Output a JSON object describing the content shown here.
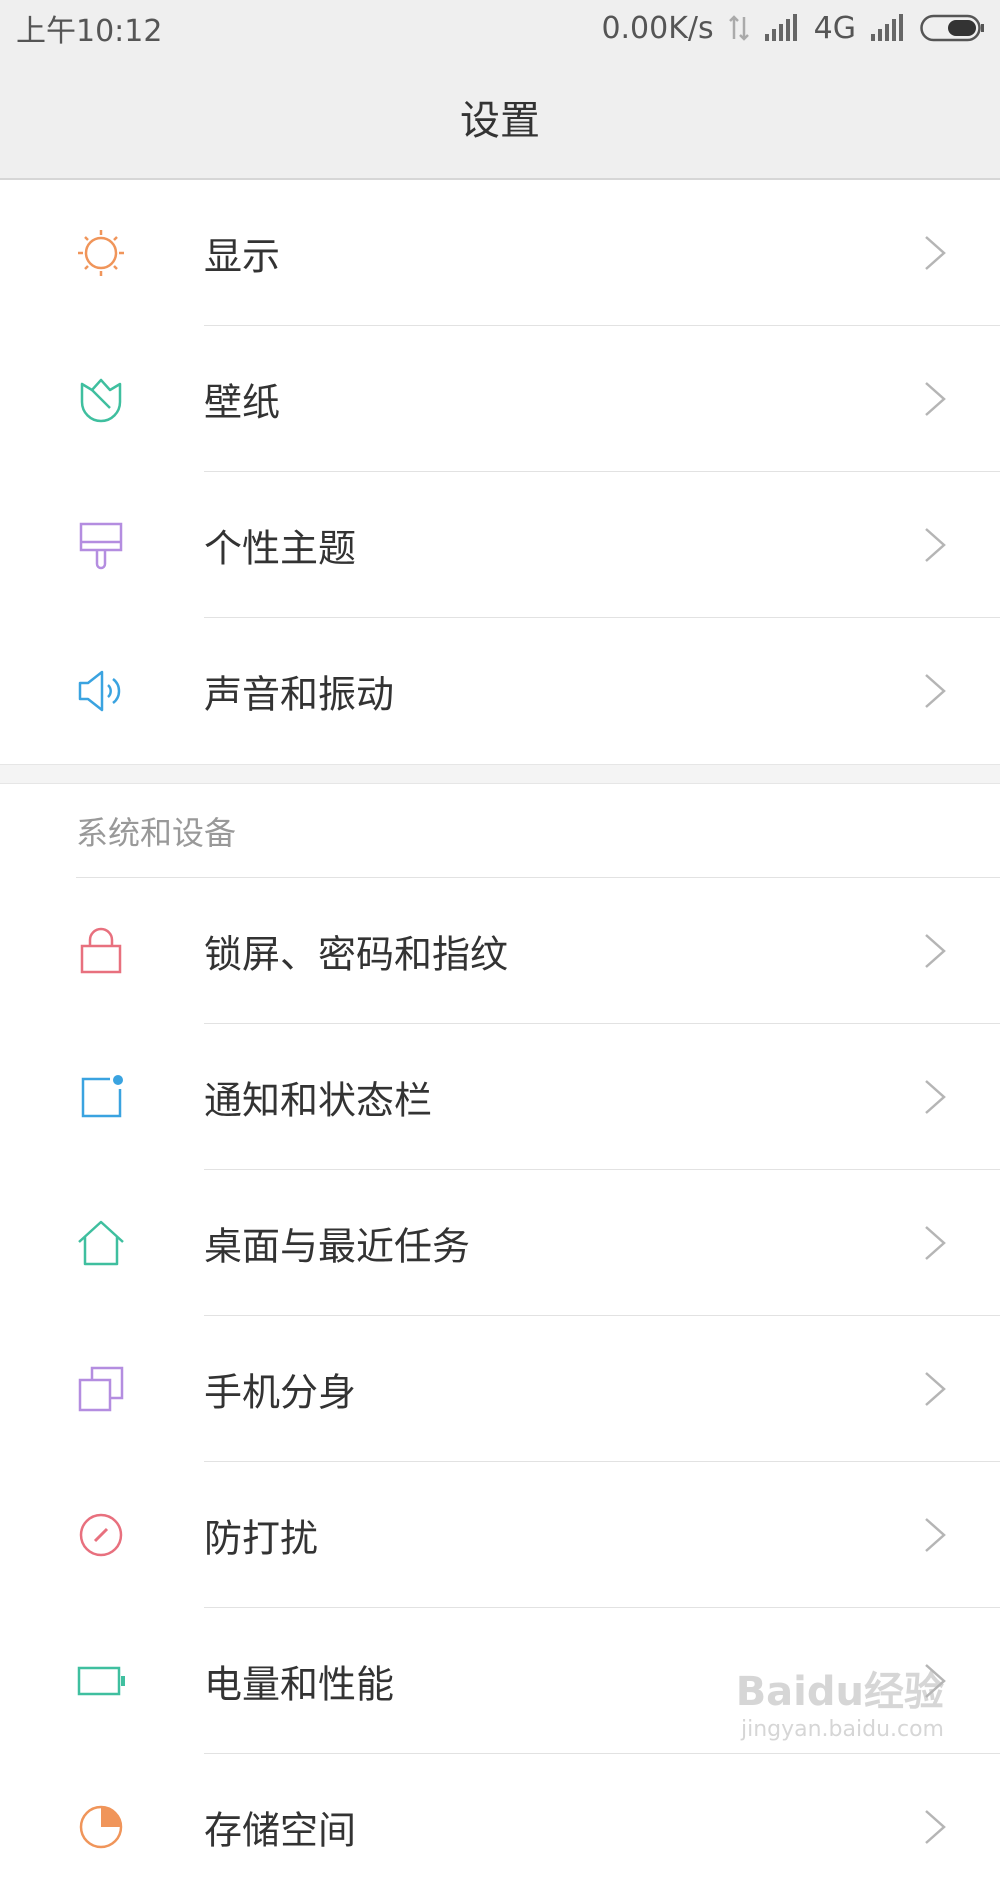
{
  "status_bar": {
    "time": "上午10:12",
    "net_speed": "0.00K/s",
    "network_type": "4G"
  },
  "header": {
    "title": "设置"
  },
  "group1": {
    "items": [
      {
        "label": "显示",
        "icon": "sun-icon",
        "color": "#f0955a"
      },
      {
        "label": "壁纸",
        "icon": "tulip-icon",
        "color": "#3fbf9f"
      },
      {
        "label": "个性主题",
        "icon": "paint-brush-icon",
        "color": "#b48de0"
      },
      {
        "label": "声音和振动",
        "icon": "speaker-icon",
        "color": "#3aa3e0"
      }
    ]
  },
  "group2": {
    "section_label": "系统和设备",
    "items": [
      {
        "label": "锁屏、密码和指纹",
        "icon": "lock-icon",
        "color": "#e8707e"
      },
      {
        "label": "通知和状态栏",
        "icon": "notification-icon",
        "color": "#3aa3e0"
      },
      {
        "label": "桌面与最近任务",
        "icon": "home-icon",
        "color": "#3fbf9f"
      },
      {
        "label": "手机分身",
        "icon": "dual-copy-icon",
        "color": "#b48de0"
      },
      {
        "label": "防打扰",
        "icon": "do-not-disturb-icon",
        "color": "#e8707e"
      },
      {
        "label": "电量和性能",
        "icon": "battery-icon",
        "color": "#3fbf9f"
      },
      {
        "label": "存储空间",
        "icon": "storage-icon",
        "color": "#f0955a"
      }
    ]
  },
  "watermark": {
    "main": "Baidu经验",
    "sub": "jingyan.baidu.com"
  }
}
